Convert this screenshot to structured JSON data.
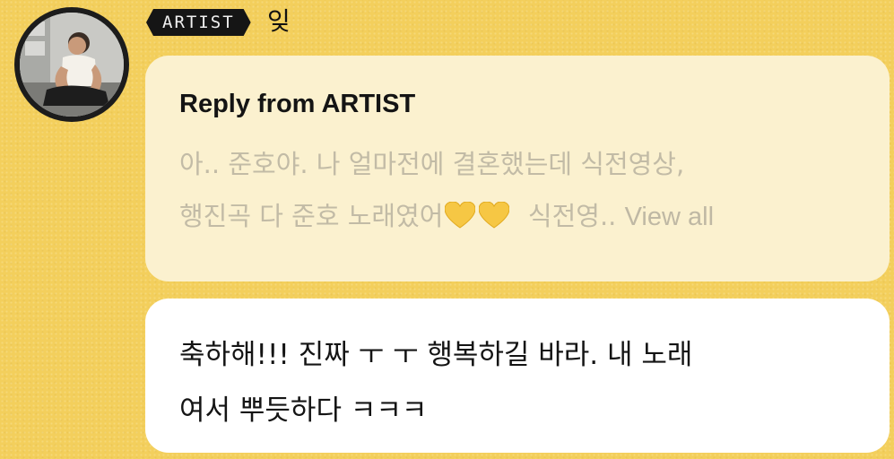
{
  "artist": {
    "badge_label": "ARTIST",
    "name": "잊"
  },
  "reply": {
    "title": "Reply from ARTIST",
    "line1": "아.. 준호야. 나 얼마전에 결혼했는데 식전영상,",
    "line2_start": "행진곡 다 준호 노래였어",
    "line2_after": "  식전영..",
    "view_all": "View all",
    "heart_icon": "yellow-heart-icon",
    "heart_color": "#f6c744"
  },
  "message": {
    "line1": "축하해!!! 진짜 ㅜ ㅜ 행복하길 바라. 내 노래",
    "line2": "여서 뿌듯하다 ㅋㅋㅋ"
  },
  "colors": {
    "background": "#f3cf5c",
    "reply_bubble": "#fbf1cf",
    "message_bubble": "#ffffff",
    "badge": "#151515"
  }
}
